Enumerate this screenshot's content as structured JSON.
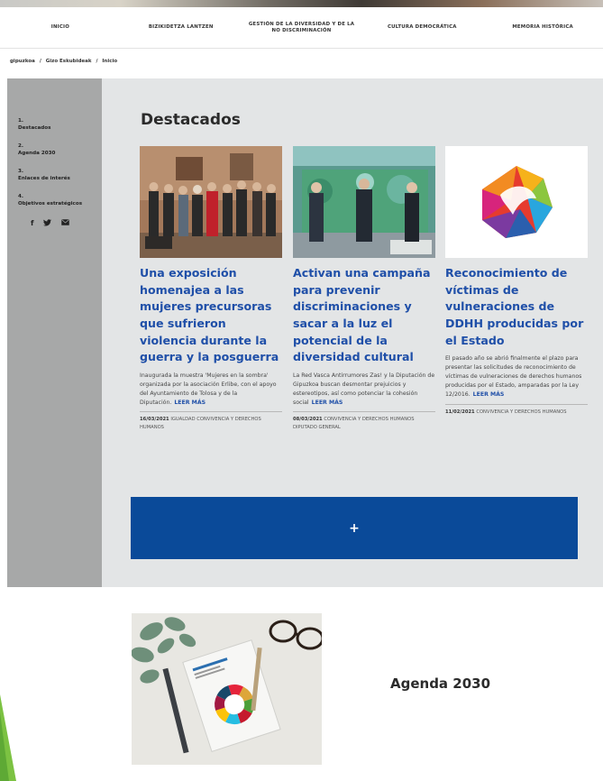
{
  "nav": {
    "items": [
      "INICIO",
      "BIZIKIDETZA LANTZEN",
      "GESTIÓN DE LA DIVERSIDAD Y DE LA NO DISCRIMINACIÓN",
      "CULTURA DEMOCRÁTICA",
      "MEMORIA HISTÓRICA"
    ]
  },
  "breadcrumb": [
    "gipuzkoa",
    "/",
    "Gizo Eskubideak",
    "/",
    "Inicio"
  ],
  "sidebar": {
    "items": [
      "1.\nDestacados",
      "2.\nAgenda 2030",
      "3.\nEnlaces de interés",
      "4.\nObjetivos estratégicos"
    ],
    "social": [
      "f",
      "🐦",
      "✉"
    ]
  },
  "featured": {
    "title": "Destacados",
    "cards": [
      {
        "title": "Una exposición homenajea a las mujeres precursoras que sufrieron violencia durante la guerra y la posguerra",
        "text": "Inaugurada la muestra 'Mujeres en la sombra' organizada por la asociación Erlibe, con el apoyo del Ayuntamiento de Tolosa y de la Diputación.",
        "more": "LEER MÁS",
        "date": "16/03/2021",
        "tags": "IGUALDAD CONVIVENCIA Y DERECHOS HUMANOS"
      },
      {
        "title": "Activan una campaña para prevenir discriminaciones y sacar a la luz el potencial de la diversidad cultural",
        "text": "La Red Vasca Antirrumores Zas! y la Diputación de Gipuzkoa buscan desmontar prejuicios y estereotipos, así como potenciar la cohesión social",
        "more": "LEER MÁS",
        "date": "08/03/2021",
        "tags": "CONVIVENCIA Y DERECHOS HUMANOS DIPUTADO GENERAL"
      },
      {
        "title": "Reconocimiento de víctimas de vulneraciones de DDHH producidas por el Estado",
        "text": "El pasado año se abrió finalmente el plazo para presentar las solicitudes de reconocimiento de víctimas de vulneraciones de derechos humanos producidas por el Estado, amparadas por la Ley 12/2016.",
        "more": "LEER MÁS",
        "date": "11/02/2021",
        "tags": "CONVIVENCIA Y DERECHOS HUMANOS"
      }
    ],
    "plus_label": "+"
  },
  "agenda": {
    "title": "Agenda 2030"
  },
  "colors": {
    "brand_blue": "#0a4a99",
    "title_blue": "#1f4fa8",
    "sidebar_gray": "#a7a8a8",
    "section_gray": "#e3e5e6"
  }
}
